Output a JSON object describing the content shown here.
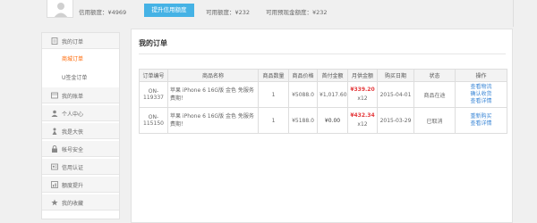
{
  "header": {
    "credit_label": "信用额度：¥4969",
    "raise_button": "提升信用额度",
    "available_label": "可用额度：¥232",
    "cash_label": "可用预现金额度：¥232"
  },
  "sidebar": {
    "items": [
      {
        "label": "我的订单",
        "icon": "document-icon"
      },
      {
        "label": "商城订单",
        "active": true
      },
      {
        "label": "U签金订单",
        "active": false
      },
      {
        "label": "我的账单",
        "icon": "bill-icon"
      },
      {
        "label": "个人中心",
        "icon": "person-icon"
      },
      {
        "label": "我是大侠",
        "icon": "hero-icon"
      },
      {
        "label": "帐号安全",
        "icon": "lock-icon"
      },
      {
        "label": "信用认证",
        "icon": "certificate-icon"
      },
      {
        "label": "额度提升",
        "icon": "chart-icon"
      },
      {
        "label": "我的收藏",
        "icon": "star-icon"
      }
    ]
  },
  "main": {
    "title": "我的订单",
    "columns": [
      "订单编号",
      "商品名称",
      "商品数量",
      "商品价格",
      "首付金额",
      "月供金额",
      "购买日期",
      "状态",
      "操作"
    ],
    "rows": [
      {
        "order_no": "ON-119337",
        "product": "苹果 iPhone 6 16G版 金色 免服务费期！",
        "qty": "1",
        "price": "¥5088.0",
        "down_payment": "¥1,017.60",
        "monthly": "¥339.20",
        "installments": "x12",
        "date": "2015-04-01",
        "status": "商品在途",
        "actions": [
          "查看物流",
          "确认收货",
          "查看详情"
        ]
      },
      {
        "order_no": "ON-115150",
        "product": "苹果 iPhone 6 16G版 金色 免服务费期！",
        "qty": "1",
        "price": "¥5188.0",
        "down_payment": "¥0.00",
        "monthly": "¥432.34",
        "installments": "x12",
        "date": "2015-03-29",
        "status": "已取消",
        "actions": [
          "重新购买",
          "查看详情"
        ]
      }
    ]
  },
  "colors": {
    "accent": "#45b2e5",
    "active_nav": "#ff6600",
    "price": "#e4393c",
    "link": "#3a86d6"
  }
}
